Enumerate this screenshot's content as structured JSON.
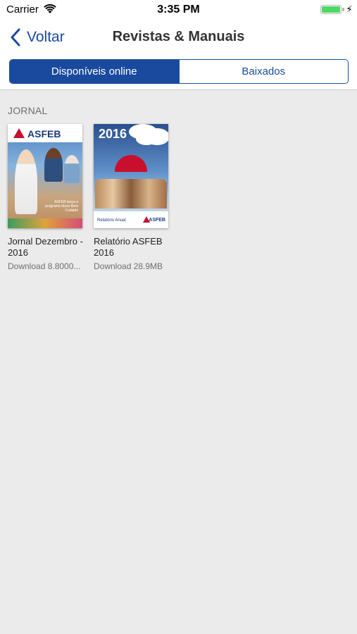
{
  "status": {
    "carrier": "Carrier",
    "time": "3:35 PM"
  },
  "nav": {
    "back_label": "Voltar",
    "title": "Revistas & Manuais"
  },
  "segments": {
    "online": "Disponíveis online",
    "downloaded": "Baixados",
    "selected": "online"
  },
  "section": {
    "header": "JORNAL",
    "items": [
      {
        "title": "Jornal Dezembro - 2016",
        "subtitle": "Download 8.8000...",
        "cover_logo": "ASFEB",
        "cover_caption": "ASFEB lança o programa Idoso Bem Cuidado"
      },
      {
        "title": "Relatório ASFEB 2016",
        "subtitle": "Download 28.9MB",
        "cover_year": "2016",
        "cover_footer": "Relatório Anual",
        "cover_logo": "ASFEB"
      }
    ]
  },
  "colors": {
    "accent": "#1a4a9e",
    "background": "#ebebeb",
    "battery": "#4cd964"
  }
}
